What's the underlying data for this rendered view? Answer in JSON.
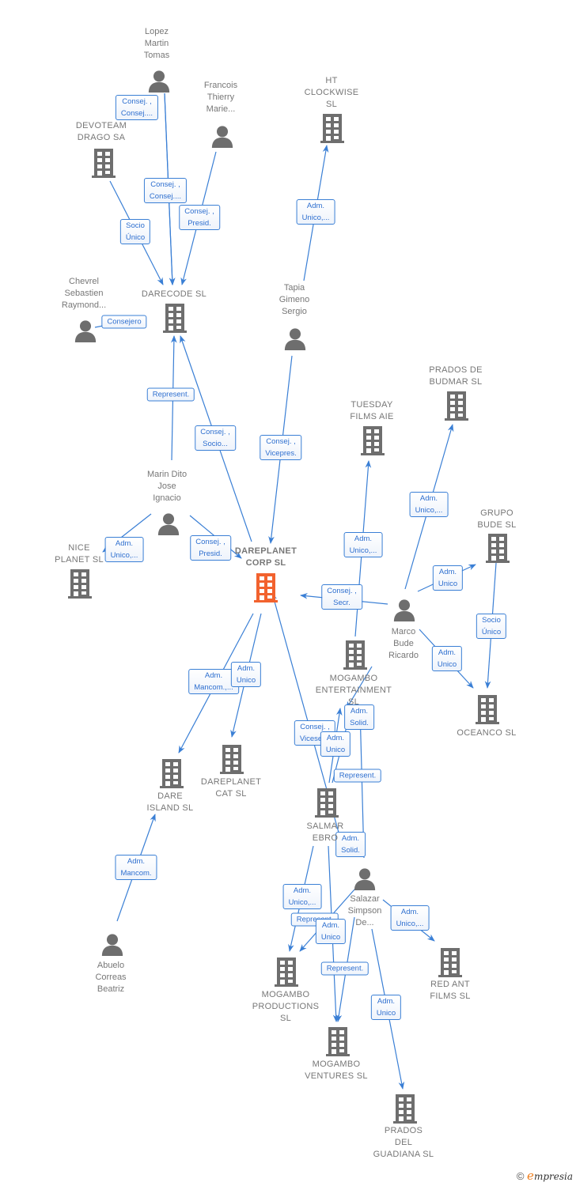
{
  "diagram": {
    "title": "DAREPLANET CORP SL",
    "colors": {
      "edge": "#3a7fd5",
      "node": "#6e6e6e",
      "main_node": "#f2622e",
      "label_text": "#777777"
    },
    "nodes": [
      {
        "id": "lopez",
        "type": "person",
        "label": "Lopez\nMartin\nTomas"
      },
      {
        "id": "francois",
        "type": "person",
        "label": "Francois\nThierry\nMarie..."
      },
      {
        "id": "devoteam",
        "type": "company",
        "label": "DEVOTEAM\nDRAGO SA"
      },
      {
        "id": "htclock",
        "type": "company",
        "label": "HT\nCLOCKWISE\nSL"
      },
      {
        "id": "chevrel",
        "type": "person",
        "label": "Chevrel\nSebastien\nRaymond..."
      },
      {
        "id": "darecode",
        "type": "company",
        "label": "DARECODE  SL"
      },
      {
        "id": "tapia",
        "type": "person",
        "label": "Tapia\nGimeno\nSergio"
      },
      {
        "id": "pradosbudmar",
        "type": "company",
        "label": "PRADOS DE\nBUDMAR  SL"
      },
      {
        "id": "tuesday",
        "type": "company",
        "label": "TUESDAY\nFILMS AIE"
      },
      {
        "id": "marin",
        "type": "person",
        "label": "Marin Dito\nJose\nIgnacio"
      },
      {
        "id": "grupobude",
        "type": "company",
        "label": "GRUPO\nBUDE  SL"
      },
      {
        "id": "niceplanet",
        "type": "company",
        "label": "NICE\nPLANET  SL"
      },
      {
        "id": "dareplanet",
        "type": "main",
        "label": "DAREPLANET\nCORP  SL"
      },
      {
        "id": "marco",
        "type": "person",
        "label": "Marco\nBude\nRicardo"
      },
      {
        "id": "mogamboent",
        "type": "company",
        "label": "MOGAMBO\nENTERTAINMENT\nSL"
      },
      {
        "id": "oceanco",
        "type": "company",
        "label": "OCEANCO  SL"
      },
      {
        "id": "dareisland",
        "type": "company",
        "label": "DARE\nISLAND  SL"
      },
      {
        "id": "dareplanetcat",
        "type": "company",
        "label": "DAREPLANET\nCAT  SL"
      },
      {
        "id": "salmar",
        "type": "company",
        "label": "SALMAR\nEBRO"
      },
      {
        "id": "salazar",
        "type": "person",
        "label": "Salazar\nSimpson\nDe..."
      },
      {
        "id": "abuelo",
        "type": "person",
        "label": "Abuelo\nCorreas\nBeatriz"
      },
      {
        "id": "redant",
        "type": "company",
        "label": "RED ANT\nFILMS SL"
      },
      {
        "id": "mogamboprod",
        "type": "company",
        "label": "MOGAMBO\nPRODUCTIONS\nSL"
      },
      {
        "id": "mogambovent",
        "type": "company",
        "label": "MOGAMBO\nVENTURES  SL"
      },
      {
        "id": "pradosguadiana",
        "type": "company",
        "label": "PRADOS\nDEL\nGUADIANA SL"
      }
    ],
    "edges": [
      {
        "from": "lopez",
        "to": "darecode",
        "label": "Consej. ,\nConsej...."
      },
      {
        "from": "lopez",
        "to": "darecode",
        "label": "Consej. ,\nConsej...."
      },
      {
        "from": "francois",
        "to": "darecode",
        "label": "Consej. ,\nPresid."
      },
      {
        "from": "devoteam",
        "to": "darecode",
        "label": "Socio\nÚnico"
      },
      {
        "from": "chevrel",
        "to": "darecode",
        "label": "Consejero"
      },
      {
        "from": "tapia",
        "to": "htclock",
        "label": "Adm.\nUnico,..."
      },
      {
        "from": "marin",
        "to": "darecode",
        "label": "Represent."
      },
      {
        "from": "dareplanet",
        "to": "darecode",
        "label": "Consej. ,\nSocio..."
      },
      {
        "from": "tapia",
        "to": "dareplanet",
        "label": "Consej. ,\nVicepres."
      },
      {
        "from": "marin",
        "to": "niceplanet",
        "label": "Adm.\nUnico,..."
      },
      {
        "from": "marin",
        "to": "dareplanet",
        "label": "Consej. ,\nPresid."
      },
      {
        "from": "marco",
        "to": "pradosbudmar",
        "label": "Adm.\nUnico,..."
      },
      {
        "from": "mogamboent",
        "to": "tuesday",
        "label": "Adm.\nUnico,..."
      },
      {
        "from": "marco",
        "to": "grupobude",
        "label": "Adm.\nUnico"
      },
      {
        "from": "marco",
        "to": "dareplanet",
        "label": "Consej. ,\nSecr."
      },
      {
        "from": "grupobude",
        "to": "oceanco",
        "label": "Socio\nÚnico"
      },
      {
        "from": "marco",
        "to": "oceanco",
        "label": "Adm.\nUnico"
      },
      {
        "from": "dareplanet",
        "to": "dareisland",
        "label": "Adm.\nMancom.,..."
      },
      {
        "from": "dareplanet",
        "to": "dareplanetcat",
        "label": "Adm.\nUnico"
      },
      {
        "from": "marco",
        "to": "mogamboent",
        "label": "Adm.\nSolid."
      },
      {
        "from": "salazar",
        "to": "dareplanet",
        "label": "Consej. ,\nVicesecr."
      },
      {
        "from": "salmar",
        "to": "mogamboent",
        "label": "Adm.\nUnico"
      },
      {
        "from": "salmar",
        "to": "mogamboent",
        "label": "Represent."
      },
      {
        "from": "salazar",
        "to": "mogamboent",
        "label": "Adm.\nSolid."
      },
      {
        "from": "abuelo",
        "to": "dareisland",
        "label": "Adm.\nMancom."
      },
      {
        "from": "salmar",
        "to": "mogamboprod",
        "label": "Adm.\nUnico,..."
      },
      {
        "from": "salazar",
        "to": "mogamboprod",
        "label": "Represent."
      },
      {
        "from": "salazar",
        "to": "mogamboprod",
        "label": "Adm.\nUnico"
      },
      {
        "from": "salazar",
        "to": "redant",
        "label": "Adm.\nUnico,..."
      },
      {
        "from": "salmar",
        "to": "mogambovent",
        "label": "Represent."
      },
      {
        "from": "salazar",
        "to": "pradosguadiana",
        "label": "Adm.\nUnico"
      }
    ]
  },
  "footer": {
    "copyright": "©",
    "brand_initial": "e",
    "brand_rest": "mpresia"
  }
}
